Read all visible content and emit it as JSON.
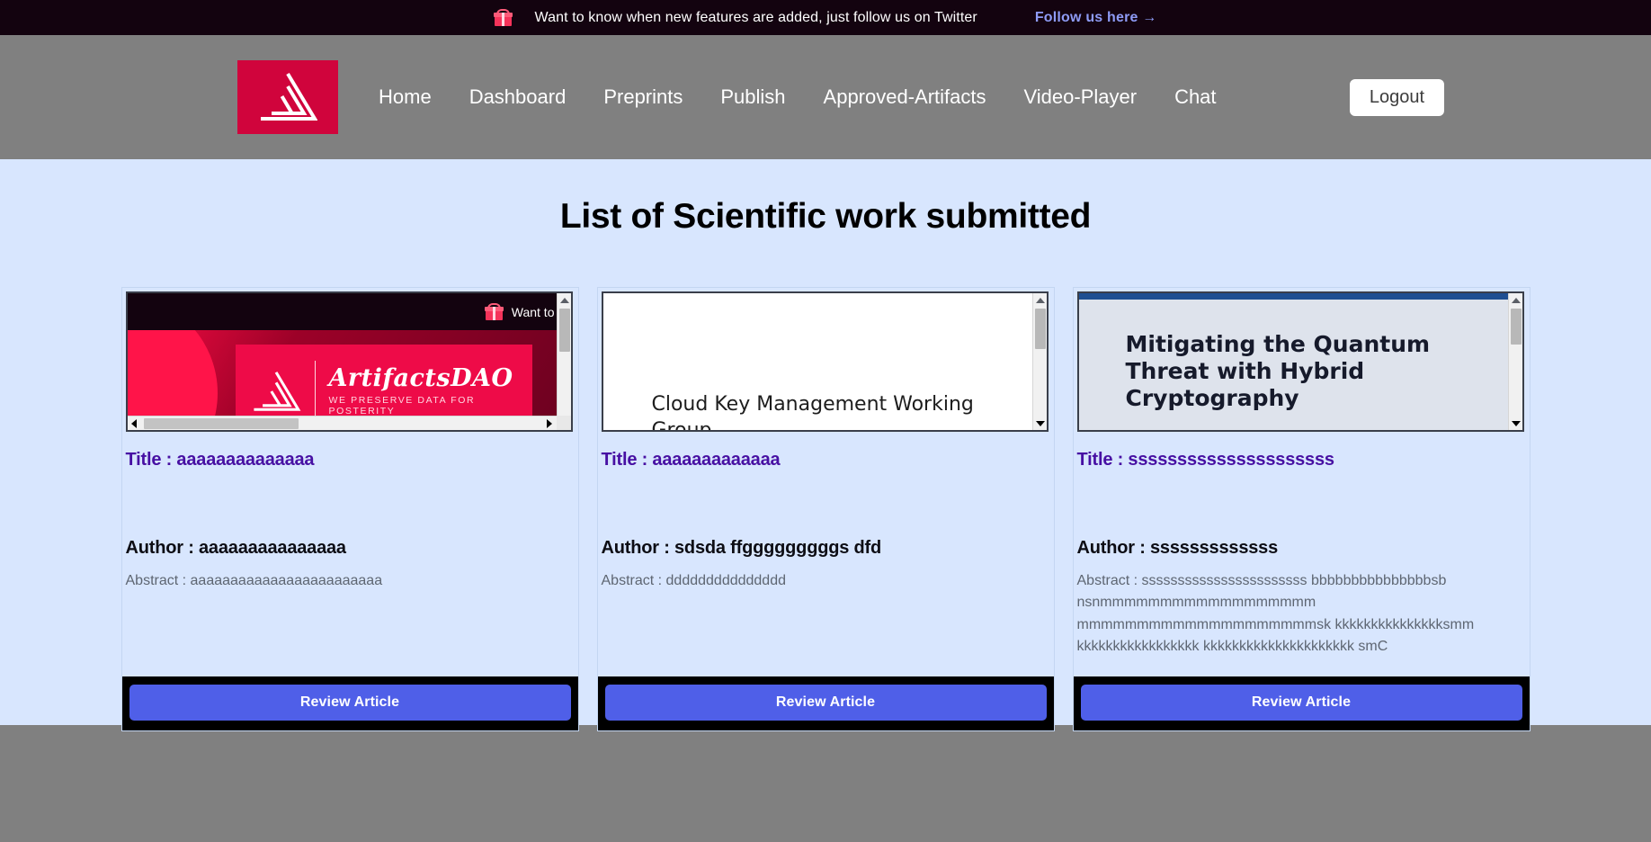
{
  "promo": {
    "icon": "gift-icon",
    "message": "Want to know when new features are added, just follow us on Twitter",
    "link_label": "Follow us here →"
  },
  "navbar": {
    "logo_name": "artifactsdao-logo",
    "links": [
      {
        "label": "Home"
      },
      {
        "label": "Dashboard"
      },
      {
        "label": "Preprints"
      },
      {
        "label": "Publish"
      },
      {
        "label": "Approved-Artifacts"
      },
      {
        "label": "Video-Player"
      },
      {
        "label": "Chat"
      }
    ],
    "logout_label": "Logout"
  },
  "main": {
    "page_title": "List of Scientific work submitted",
    "review_button_label": "Review Article",
    "cards": [
      {
        "preview_kind": "artifactsdao-site",
        "preview": {
          "promo_text": "Want to",
          "wordmark": "ArtifactsDAO",
          "tagline": "WE PRESERVE DATA FOR POSTERITY"
        },
        "title": "Title : aaaaaaaaaaaaaa",
        "author": "Author : aaaaaaaaaaaaaaa",
        "abstract": "Abstract : aaaaaaaaaaaaaaaaaaaaaaaa"
      },
      {
        "preview_kind": "pdf-document",
        "preview": {
          "doc_title": "Cloud Key Management Working Group"
        },
        "title": "Title : aaaaaaaaaaaaa",
        "author": "Author : sdsda ffgggggggggs dfd",
        "abstract": "Abstract : ddddddddddddddd"
      },
      {
        "preview_kind": "light-document",
        "preview": {
          "doc_title": "Mitigating the Quantum Threat with Hybrid Cryptography"
        },
        "title": "Title : sssssssssssssssssssss",
        "author": "Author : sssssssssssss",
        "abstract": "Abstract : sssssssssssssssssssssss bbbbbbbbbbbbbbbsb nsnmmmmmmmmmmmmmmmmmm mmmmmmmmmmmmmmmmmmmmsk kkkkkkkkkkkkkkksmm kkkkkkkkkkkkkkkkk kkkkkkkkkkkkkkkkkkkkk smC"
      }
    ]
  },
  "colors": {
    "page_background": "#d8e6fe",
    "navbar_background": "#808080",
    "banner_background": "#13030f",
    "brand_crimson": "#d0043c",
    "title_purple": "#4710a3",
    "button_blue": "#4f5fe8",
    "promo_link": "#8e9bf5"
  }
}
